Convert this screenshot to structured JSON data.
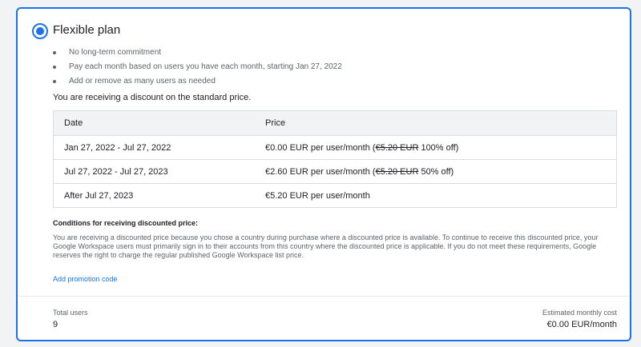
{
  "plan": {
    "title": "Flexible plan",
    "selected": true,
    "features": [
      "No long-term commitment",
      "Pay each month based on users you have each month, starting Jan 27, 2022",
      "Add or remove as many users as needed"
    ]
  },
  "discount_note": "You are receiving a discount on the standard price.",
  "pricing_table": {
    "headers": {
      "date": "Date",
      "price": "Price"
    },
    "rows": [
      {
        "date": "Jan 27, 2022 - Jul 27, 2022",
        "price": "€0.00 EUR per user/month (",
        "struck": "€5.20 EUR",
        "suffix": " 100% off)"
      },
      {
        "date": "Jul 27, 2022 - Jul 27, 2023",
        "price": "€2.60 EUR per user/month (",
        "struck": "€5.20 EUR",
        "suffix": " 50% off)"
      },
      {
        "date": "After Jul 27, 2023",
        "price": "€5.20 EUR per user/month",
        "struck": "",
        "suffix": ""
      }
    ]
  },
  "conditions": {
    "title": "Conditions for receiving discounted price:",
    "text": "You are receiving a discounted price because you chose a country during purchase where a discounted price is available. To continue to receive this discounted price, your Google Workspace users must primarily sign in to their accounts from this country where the discounted price is applicable. If you do not meet these requirements, Google reserves the right to charge the regular published Google Workspace list price."
  },
  "promo_link": "Add promotion code",
  "footer": {
    "total_users_label": "Total users",
    "total_users_value": "9",
    "estimated_cost_label": "Estimated monthly cost",
    "estimated_cost_value": "€0.00 EUR/month"
  },
  "colors": {
    "accent": "#1a73e8",
    "text": "#202124",
    "secondary_text": "#5f6368",
    "table_header_bg": "#f1f3f4",
    "border": "#dadce0"
  }
}
